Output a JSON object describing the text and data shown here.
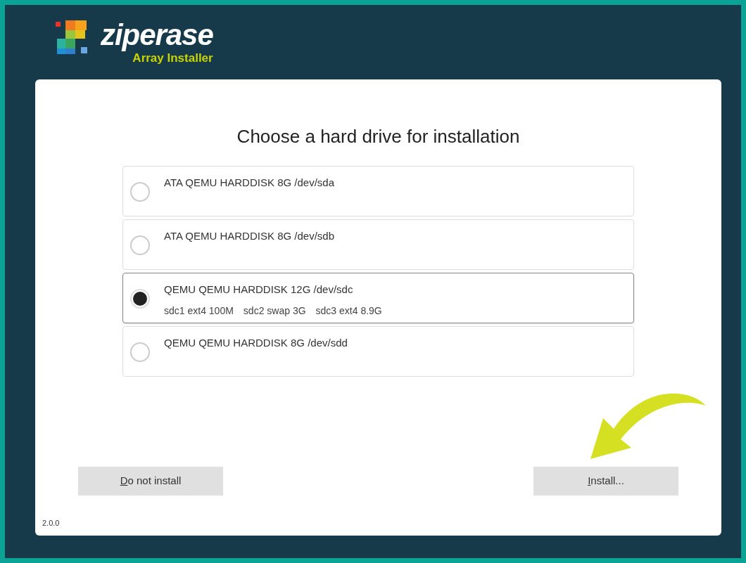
{
  "logo": {
    "name": "ziperase",
    "subtitle": "Array Installer"
  },
  "heading": "Choose a hard drive for installation",
  "drives": [
    {
      "title": "ATA QEMU HARDDISK 8G /dev/sda",
      "selected": false
    },
    {
      "title": "ATA QEMU HARDDISK 8G /dev/sdb",
      "selected": false
    },
    {
      "title": "QEMU QEMU HARDDISK 12G /dev/sdc",
      "partitions": [
        "sdc1 ext4 100M",
        "sdc2 swap 3G",
        "sdc3 ext4 8.9G"
      ],
      "selected": true
    },
    {
      "title": "QEMU QEMU HARDDISK 8G /dev/sdd",
      "selected": false
    }
  ],
  "buttons": [
    {
      "label": "Do not install",
      "mnemonic_first_letter": true
    },
    {
      "label": "Install...",
      "mnemonic_first_letter": true
    }
  ],
  "version": "2.0.0"
}
